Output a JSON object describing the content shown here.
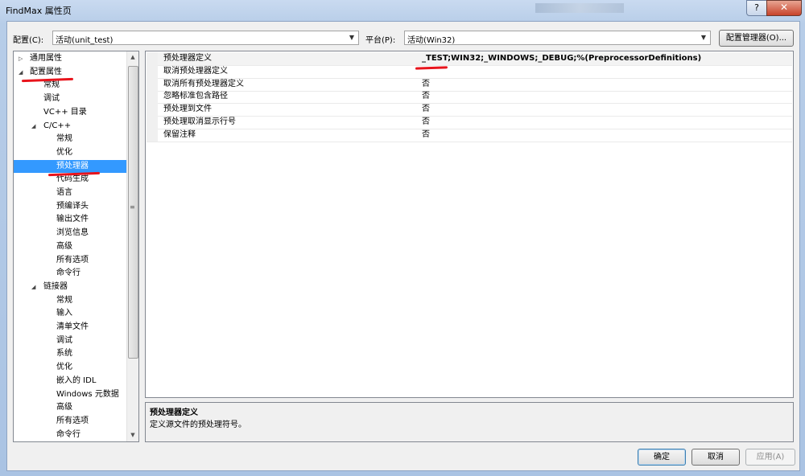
{
  "window": {
    "title": "FindMax 属性页",
    "help_glyph": "?",
    "close_glyph": "✕"
  },
  "config_bar": {
    "config_label": "配置(C):",
    "config_value": "活动(unit_test)",
    "platform_label": "平台(P):",
    "platform_value": "活动(Win32)",
    "manager_button": "配置管理器(O)..."
  },
  "tree": {
    "items": [
      {
        "label": "通用属性",
        "level": 0,
        "expander": "▷"
      },
      {
        "label": "配置属性",
        "level": 0,
        "expander": "◢"
      },
      {
        "label": "常规",
        "level": 1,
        "expander": ""
      },
      {
        "label": "调试",
        "level": 1,
        "expander": ""
      },
      {
        "label": "VC++ 目录",
        "level": 1,
        "expander": ""
      },
      {
        "label": "C/C++",
        "level": 1,
        "expander": "◢"
      },
      {
        "label": "常规",
        "level": 2,
        "expander": ""
      },
      {
        "label": "优化",
        "level": 2,
        "expander": ""
      },
      {
        "label": "预处理器",
        "level": 2,
        "expander": "",
        "selected": true
      },
      {
        "label": "代码生成",
        "level": 2,
        "expander": ""
      },
      {
        "label": "语言",
        "level": 2,
        "expander": ""
      },
      {
        "label": "预编译头",
        "level": 2,
        "expander": ""
      },
      {
        "label": "输出文件",
        "level": 2,
        "expander": ""
      },
      {
        "label": "浏览信息",
        "level": 2,
        "expander": ""
      },
      {
        "label": "高级",
        "level": 2,
        "expander": ""
      },
      {
        "label": "所有选项",
        "level": 2,
        "expander": ""
      },
      {
        "label": "命令行",
        "level": 2,
        "expander": ""
      },
      {
        "label": "链接器",
        "level": 1,
        "expander": "◢"
      },
      {
        "label": "常规",
        "level": 2,
        "expander": ""
      },
      {
        "label": "输入",
        "level": 2,
        "expander": ""
      },
      {
        "label": "清单文件",
        "level": 2,
        "expander": ""
      },
      {
        "label": "调试",
        "level": 2,
        "expander": ""
      },
      {
        "label": "系统",
        "level": 2,
        "expander": ""
      },
      {
        "label": "优化",
        "level": 2,
        "expander": ""
      },
      {
        "label": "嵌入的 IDL",
        "level": 2,
        "expander": ""
      },
      {
        "label": "Windows 元数据",
        "level": 2,
        "expander": ""
      },
      {
        "label": "高级",
        "level": 2,
        "expander": ""
      },
      {
        "label": "所有选项",
        "level": 2,
        "expander": ""
      },
      {
        "label": "命令行",
        "level": 2,
        "expander": ""
      }
    ],
    "scroll_up": "▲",
    "scroll_down": "▼",
    "scroll_grip": "≡"
  },
  "properties": [
    {
      "name": "预处理器定义",
      "value": "_TEST;WIN32;_WINDOWS;_DEBUG;%(PreprocessorDefinitions)"
    },
    {
      "name": "取消预处理器定义",
      "value": ""
    },
    {
      "name": "取消所有预处理器定义",
      "value": "否"
    },
    {
      "name": "忽略标准包含路径",
      "value": "否"
    },
    {
      "name": "预处理到文件",
      "value": "否"
    },
    {
      "name": "预处理取消显示行号",
      "value": "否"
    },
    {
      "name": "保留注释",
      "value": "否"
    }
  ],
  "description": {
    "title": "预处理器定义",
    "text": "定义源文件的预处理符号。"
  },
  "footer": {
    "ok": "确定",
    "cancel": "取消",
    "apply": "应用(A)"
  },
  "colors": {
    "selection": "#3399ff",
    "annotation": "#e8141c"
  }
}
